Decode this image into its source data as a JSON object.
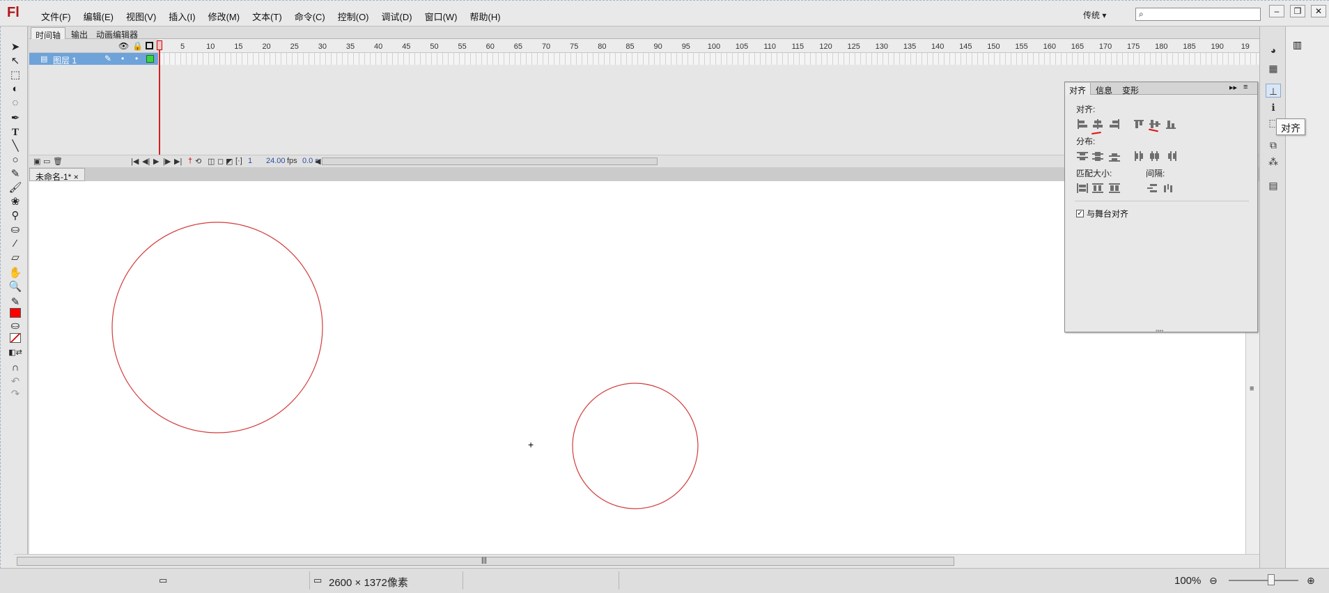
{
  "app": {
    "logo": "Fl"
  },
  "menu": [
    "文件(F)",
    "编辑(E)",
    "视图(V)",
    "插入(I)",
    "修改(M)",
    "文本(T)",
    "命令(C)",
    "控制(O)",
    "调试(D)",
    "窗口(W)",
    "帮助(H)"
  ],
  "workspace": {
    "label": "传统",
    "arrow": "▾"
  },
  "search": {
    "value": ""
  },
  "timeline": {
    "tabs": [
      "时间轴",
      "输出",
      "动画编辑器"
    ],
    "layer_name": "图层 1",
    "ruler_ticks": [
      "1",
      "5",
      "10",
      "15",
      "20",
      "25",
      "30",
      "35",
      "40",
      "45",
      "50",
      "55",
      "60",
      "65",
      "70",
      "75",
      "80",
      "85",
      "90",
      "95",
      "100",
      "105",
      "110",
      "115",
      "120",
      "125",
      "130",
      "135",
      "140",
      "145",
      "150",
      "155",
      "160",
      "165",
      "170",
      "175",
      "180",
      "185",
      "190",
      "19"
    ],
    "current_frame": "1",
    "fps": "24.00",
    "fps_unit": "fps",
    "time": "0.0 s"
  },
  "document": {
    "tab": "未命名-1*"
  },
  "stage": {
    "circles": [
      {
        "name": "large-circle"
      },
      {
        "name": "small-circle"
      }
    ],
    "stroke": "#d43a3a"
  },
  "align_panel": {
    "tabs": [
      "对齐",
      "信息",
      "变形"
    ],
    "align_label": "对齐:",
    "distribute_label": "分布:",
    "match_label": "匹配大小:",
    "spacing_label": "间隔:",
    "stage_checkbox": "与舞台对齐",
    "stage_checked": true
  },
  "tooltip": "对齐",
  "status": {
    "dimensions": "2600 × 1372像素",
    "zoom": "100%"
  },
  "colors": {
    "stroke": "#d41a1a",
    "fill": "#ff0000",
    "accent": "#6ea3d9"
  }
}
